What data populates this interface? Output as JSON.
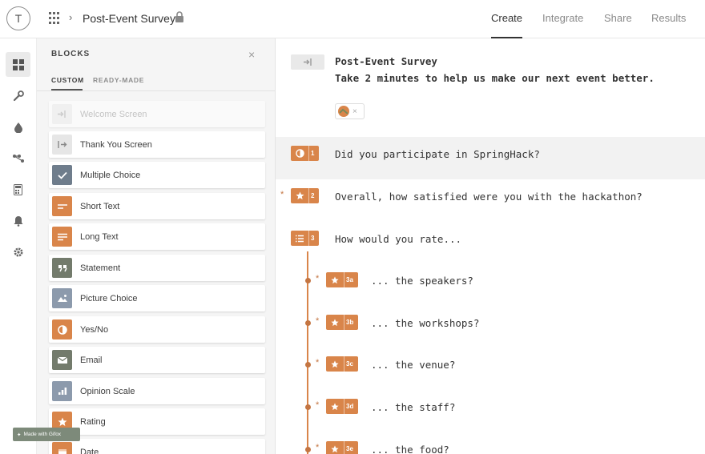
{
  "header": {
    "avatar_letter": "T",
    "form_title": "Post-Event Survey",
    "tabs": [
      {
        "label": "Create",
        "active": true
      },
      {
        "label": "Integrate",
        "active": false
      },
      {
        "label": "Share",
        "active": false
      },
      {
        "label": "Results",
        "active": false
      }
    ]
  },
  "rail": {
    "items": [
      {
        "icon": "blocks-grid-icon",
        "active": true
      },
      {
        "icon": "wrench-icon",
        "active": false
      },
      {
        "icon": "drop-icon",
        "active": false
      },
      {
        "icon": "logic-branch-icon",
        "active": false
      },
      {
        "icon": "calculator-icon",
        "active": false
      },
      {
        "icon": "bell-icon",
        "active": false
      },
      {
        "icon": "gear-icon",
        "active": false
      }
    ]
  },
  "panel": {
    "title": "BLOCKS",
    "close_glyph": "×",
    "subtabs": [
      {
        "label": "CUSTOM",
        "active": true
      },
      {
        "label": "READY-MADE",
        "active": false
      }
    ],
    "blocks": [
      {
        "label": "Welcome Screen",
        "icon": "welcome-icon",
        "color": "#c9c9c9",
        "disabled": true
      },
      {
        "label": "Thank You Screen",
        "icon": "thank-you-icon",
        "color": "#d1d1d1",
        "disabled": false
      },
      {
        "label": "Multiple Choice",
        "icon": "checkmark-icon",
        "color": "#6f7d8c",
        "disabled": false
      },
      {
        "label": "Short Text",
        "icon": "short-text-icon",
        "color": "#d9854a",
        "disabled": false
      },
      {
        "label": "Long Text",
        "icon": "long-text-icon",
        "color": "#d9854a",
        "disabled": false
      },
      {
        "label": "Statement",
        "icon": "quote-icon",
        "color": "#737b6c",
        "disabled": false
      },
      {
        "label": "Picture Choice",
        "icon": "picture-icon",
        "color": "#8c9aac",
        "disabled": false
      },
      {
        "label": "Yes/No",
        "icon": "yes-no-icon",
        "color": "#d9854a",
        "disabled": false
      },
      {
        "label": "Email",
        "icon": "envelope-icon",
        "color": "#737b6c",
        "disabled": false
      },
      {
        "label": "Opinion Scale",
        "icon": "bar-scale-icon",
        "color": "#8c9aac",
        "disabled": false
      },
      {
        "label": "Rating",
        "icon": "star-icon",
        "color": "#d9854a",
        "disabled": false
      },
      {
        "label": "Date",
        "icon": "calendar-icon",
        "color": "#d9854a",
        "disabled": false
      }
    ]
  },
  "canvas": {
    "welcome": {
      "title": "Post-Event Survey",
      "subtitle": "Take 2 minutes to help us make our next event better."
    },
    "questions": [
      {
        "number": "1",
        "text": "Did you participate in SpringHack?",
        "icon": "yes-no-icon",
        "required": false
      },
      {
        "number": "2",
        "text": "Overall, how satisfied were you with the hackathon?",
        "icon": "star-icon",
        "required": true
      },
      {
        "number": "3",
        "text": "How would you rate...",
        "icon": "list-icon",
        "required": false
      }
    ],
    "subquestions": [
      {
        "number": "3a",
        "text": "... the speakers?"
      },
      {
        "number": "3b",
        "text": "... the workshops?"
      },
      {
        "number": "3c",
        "text": "... the venue?"
      },
      {
        "number": "3d",
        "text": "... the staff?"
      },
      {
        "number": "3e",
        "text": "... the food?"
      }
    ],
    "required_mark": "*"
  },
  "watermark": "Made with Gifox",
  "colors": {
    "accent_orange": "#d9854a",
    "muted_gray": "#8a8a8a"
  }
}
